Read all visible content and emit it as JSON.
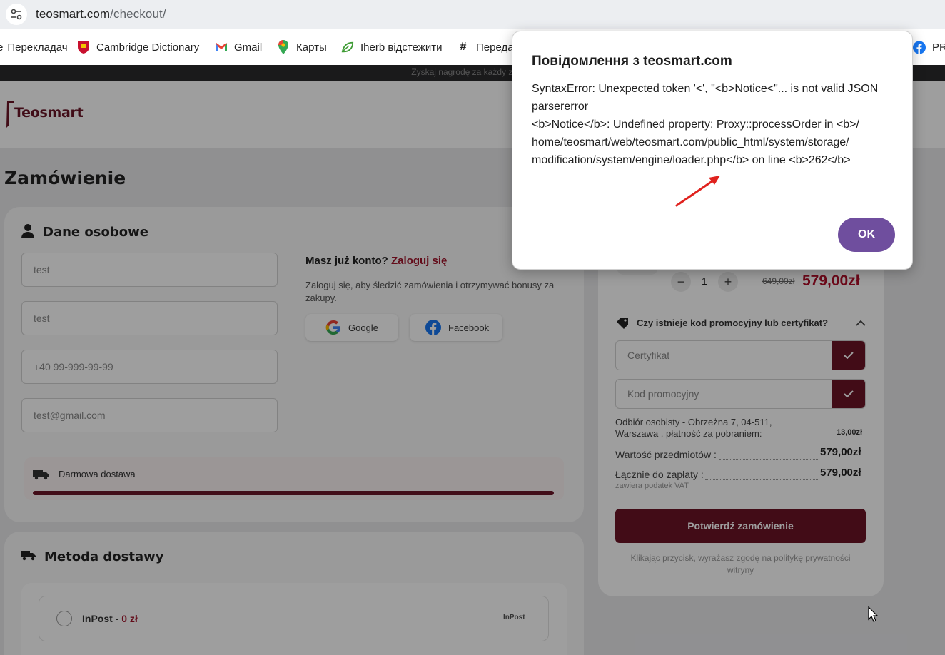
{
  "browser": {
    "url_domain": "teosmart.com",
    "url_path": "/checkout/",
    "bookmarks": [
      {
        "label": "Перекладач",
        "icon": "translate-icon"
      },
      {
        "label": "Cambridge Dictionary",
        "icon": "cambridge-shield-icon"
      },
      {
        "label": "Gmail",
        "icon": "gmail-icon"
      },
      {
        "label": "Карты",
        "icon": "maps-pin-icon"
      },
      {
        "label": "Iherb відстежити",
        "icon": "iherb-leaf-icon"
      },
      {
        "label": "Переда",
        "icon": "hash-icon"
      },
      {
        "label": "PR",
        "icon": "facebook-icon"
      }
    ]
  },
  "site": {
    "promo_text": "Zyskaj nagrodę za każdy zakup!",
    "logo": "Teosmart",
    "page_title": "Zamówienie"
  },
  "personal": {
    "title": "Dane osobowe",
    "fields": [
      "test",
      "test",
      "+40 99-999-99-99",
      "test@gmail.com"
    ],
    "account_prompt": "Masz już konto?",
    "login_link": "Zaloguj się",
    "login_hint": "Zaloguj się, aby śledzić zamówienia i otrzymywać bonusy za zakupy.",
    "google_label": "Google",
    "facebook_label": "Facebook",
    "free_delivery": "Darmowa dostawa",
    "free_delivery_progress": 1.0
  },
  "delivery": {
    "title": "Metoda dostawy",
    "option_name": "InPost - ",
    "option_price": "0 zł",
    "option_logo": "InPost"
  },
  "summary": {
    "quantity": "1",
    "old_price": "649,00zł",
    "price": "579,00zł",
    "promo_question": "Czy istnieje kod promocyjny lub certyfikat?",
    "certificate_placeholder": "Certyfikat",
    "promo_placeholder": "Kod promocyjny",
    "pickup_line1": "Odbiór osobisty - Obrzeżna 7, 04-511,",
    "pickup_line2": "Warszawa , płatność za pobraniem:",
    "pickup_value": "13,00zł",
    "items_label": "Wartość przedmiotów :",
    "items_value": "579,00zł",
    "total_label": "Łącznie do zapłaty :",
    "total_value": "579,00zł",
    "vat_note": "zawiera podatek VAT",
    "confirm_label": "Potwierdź zamówienie",
    "policy_line1": "Klikając przycisk, wyrażasz zgodę na politykę prywatności",
    "policy_line2": "witryny"
  },
  "dialog": {
    "title": "Повідомлення з teosmart.com",
    "lines": [
      "SyntaxError: Unexpected token '<', \"<b>Notice<\"... is not valid JSON",
      "parsererror",
      "<b>Notice</b>:  Undefined property: Proxy::processOrder in <b>/",
      "home/teosmart/web/teosmart.com/public_html/system/storage/",
      "modification/system/engine/loader.php</b> on line <b>262</b>"
    ],
    "ok_label": "OK"
  },
  "colors": {
    "brand": "#6b1426",
    "dialog_button": "#6f4e9e",
    "annotation_arrow": "#e0221e"
  }
}
